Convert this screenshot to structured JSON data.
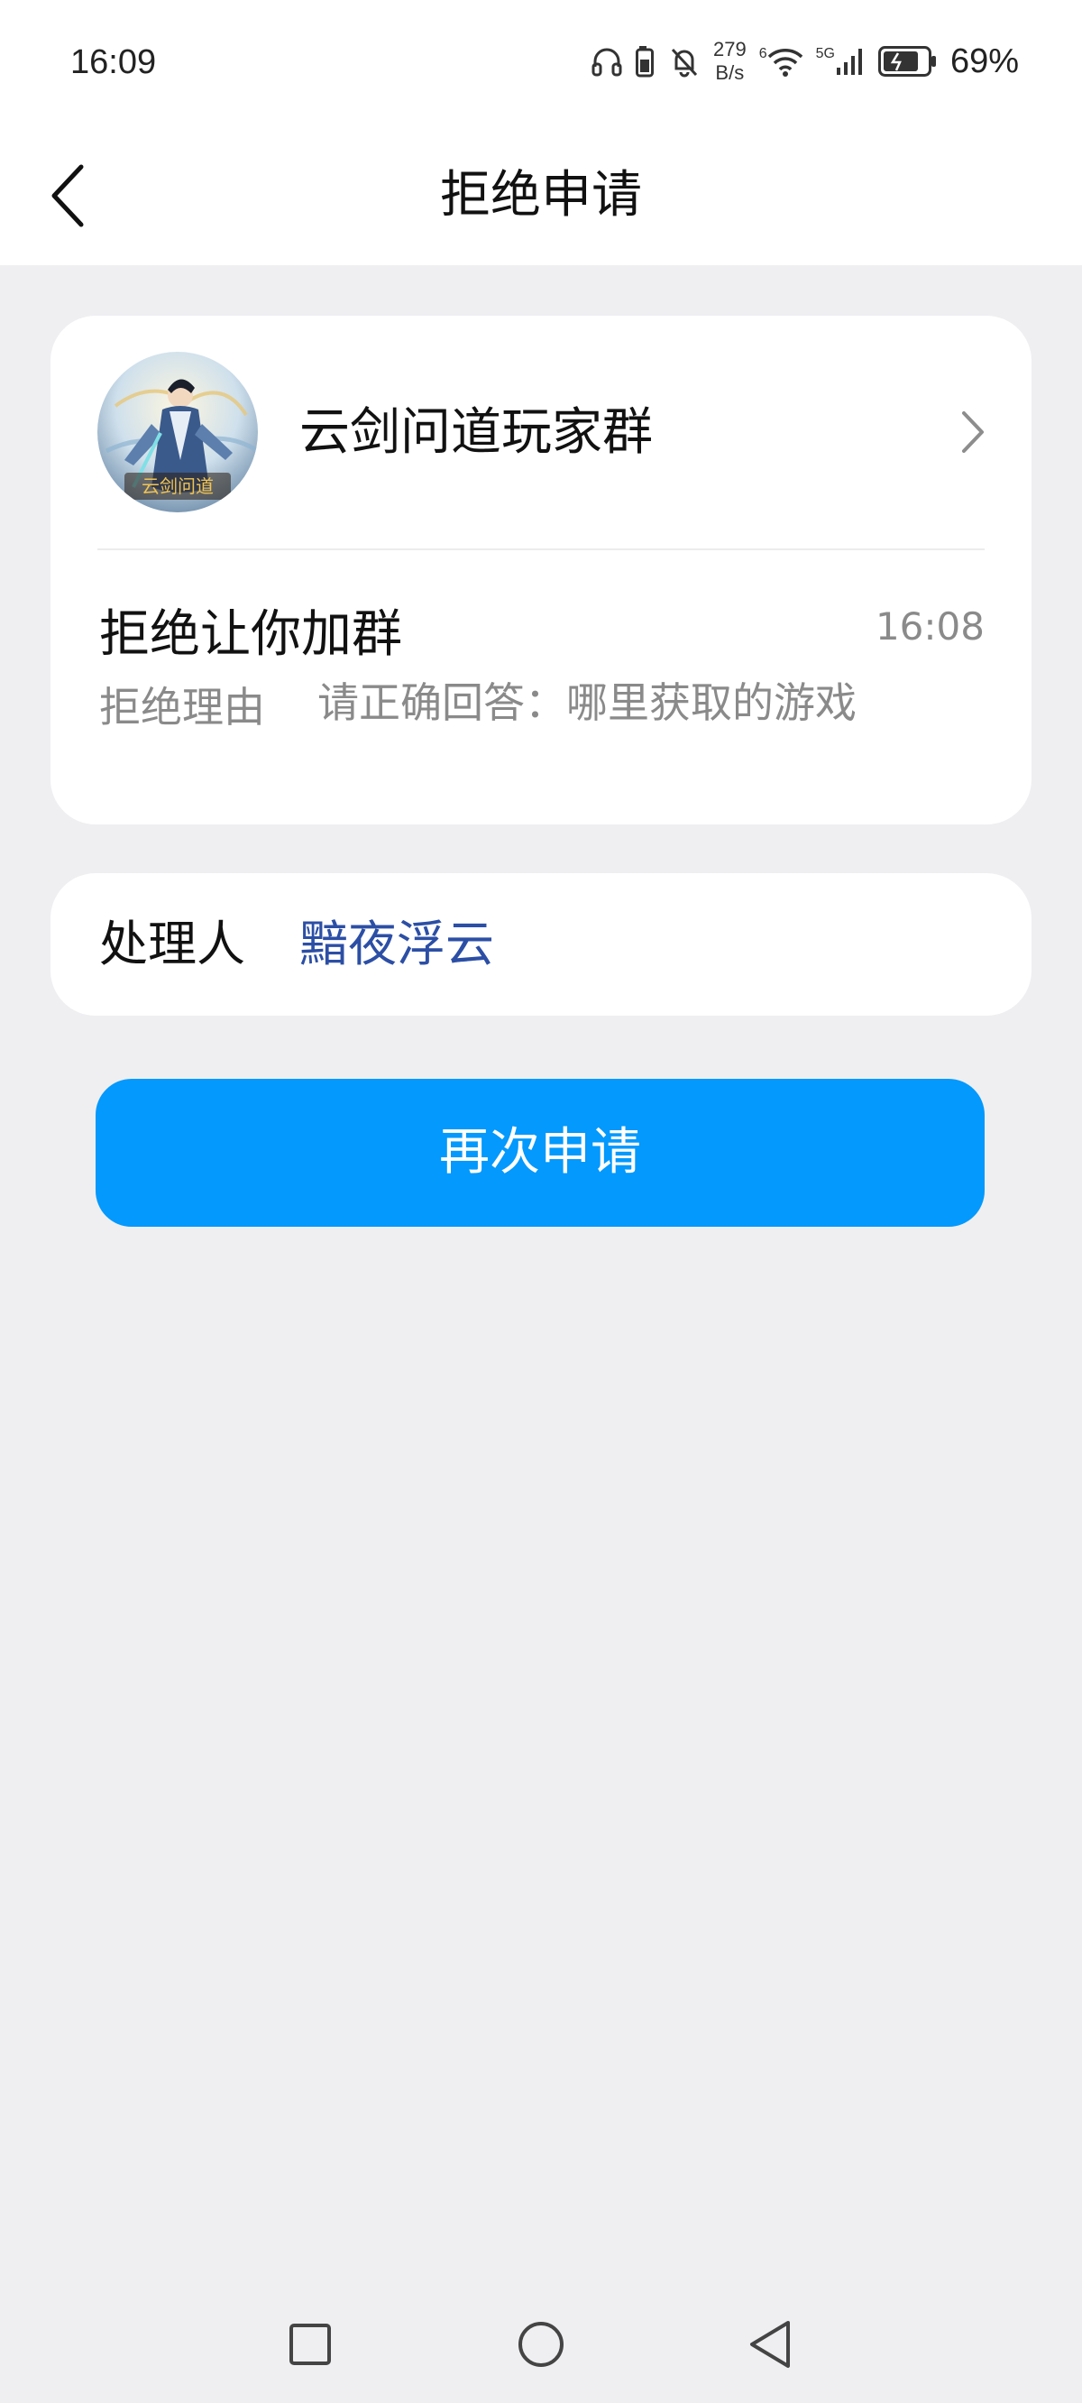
{
  "status_bar": {
    "time": "16:09",
    "net_speed_value": "279",
    "net_speed_unit": "B/s",
    "wifi_badge": "6",
    "cell_badge": "5G",
    "battery_percent": "69%"
  },
  "header": {
    "title": "拒绝申请"
  },
  "group": {
    "name": "云剑问道玩家群",
    "avatar_text": "云剑问道"
  },
  "rejection": {
    "title": "拒绝让你加群",
    "time": "16:08",
    "reason_label": "拒绝理由",
    "reason_text": "请正确回答：哪里获取的游戏"
  },
  "handler": {
    "label": "处理人",
    "name": "黯夜浮云"
  },
  "actions": {
    "reapply_label": "再次申请"
  },
  "colors": {
    "primary_button": "#0399fd",
    "handler_link": "#2c4fa5",
    "page_background": "#efeff2"
  }
}
